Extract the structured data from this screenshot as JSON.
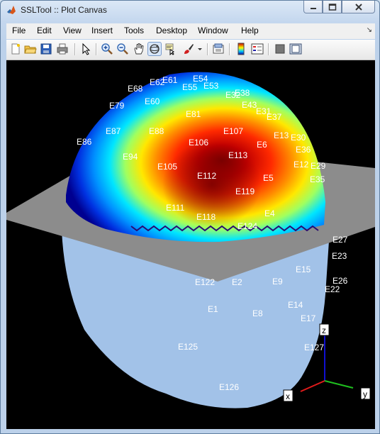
{
  "window": {
    "title": "SSLTool :: Plot Canvas"
  },
  "menu": {
    "items": [
      "File",
      "Edit",
      "View",
      "Insert",
      "Tools",
      "Desktop",
      "Window",
      "Help"
    ],
    "overflow_arrow": "↘"
  },
  "toolbar": {
    "icons": [
      "new-figure-icon",
      "open-file-icon",
      "save-icon",
      "print-icon",
      "pointer-icon",
      "zoom-in-icon",
      "zoom-out-icon",
      "pan-hand-icon",
      "rotate-3d-icon",
      "data-cursor-icon",
      "brush-icon",
      "brush-dropdown-icon",
      "link-plot-icon",
      "colorbar-icon",
      "legend-icon",
      "hide-plot-tools-icon",
      "show-plot-tools-icon"
    ],
    "pressed": "rotate-3d-icon"
  },
  "plot": {
    "axis_labels": {
      "x": "x",
      "y": "y",
      "z": "z"
    },
    "colors": {
      "background": "#000000",
      "head": "#a2c2e8",
      "plane": "#8c8c8c",
      "axis_x": "#e01b1b",
      "axis_y": "#1fbf1f",
      "axis_z": "#1010d0"
    },
    "labels_top": [
      "E54",
      "E61",
      "E62",
      "E68",
      "E55",
      "E53",
      "E38",
      "E32",
      "E43",
      "E60",
      "E79",
      "E31",
      "E37",
      "E81",
      "E107",
      "E87",
      "E88",
      "E13",
      "E30",
      "E106",
      "E86",
      "E36",
      "E6",
      "E113",
      "E94",
      "E12",
      "E29",
      "E105",
      "E112",
      "E5",
      "E35",
      "E119",
      "E111",
      "E4",
      "E118",
      "E124"
    ],
    "labels_bottom": [
      "E27",
      "E23",
      "E15",
      "E122",
      "E2",
      "E9",
      "E26",
      "E22",
      "E1",
      "E8",
      "E14",
      "E17",
      "E127",
      "E125",
      "E126"
    ]
  }
}
